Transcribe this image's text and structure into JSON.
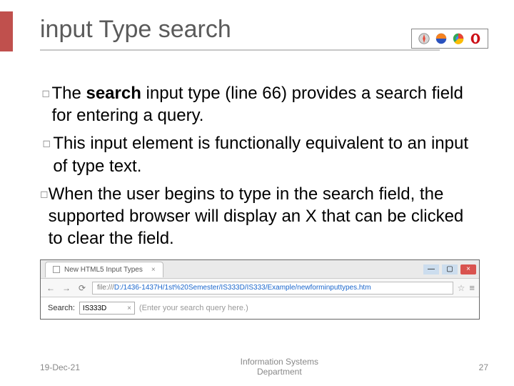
{
  "title": "input Type search",
  "browser_badges": [
    "safari",
    "firefox",
    "chrome",
    "opera"
  ],
  "bullets": [
    "The <b>search</b> input type (line 66) provides a search field for entering a query.",
    "This input element is functionally equivalent to an input of type text.",
    "When the user begins to type in the search field, the supported browser will display an X that can be clicked to clear the field."
  ],
  "screenshot": {
    "tab_label": "New HTML5 Input Types",
    "tab_close_glyph": "×",
    "nav": {
      "back": "←",
      "forward": "→",
      "reload": "⟳"
    },
    "url_prefix": "file:///",
    "url_path": "D:/1436-1437H/1st%20Semester/IS333D/IS333/Example/newforminputtypes.htm",
    "star_glyph": "☆",
    "menu_glyph": "≡",
    "win": {
      "min": "—",
      "max": "▢",
      "close": "×"
    },
    "form_label": "Search:",
    "form_value": "IS333D",
    "clear_glyph": "×",
    "placeholder_text": "(Enter your search query here.)"
  },
  "footer": {
    "date": "19-Dec-21",
    "department_line1": "Information Systems",
    "department_line2": "Department",
    "page_number": "27"
  }
}
